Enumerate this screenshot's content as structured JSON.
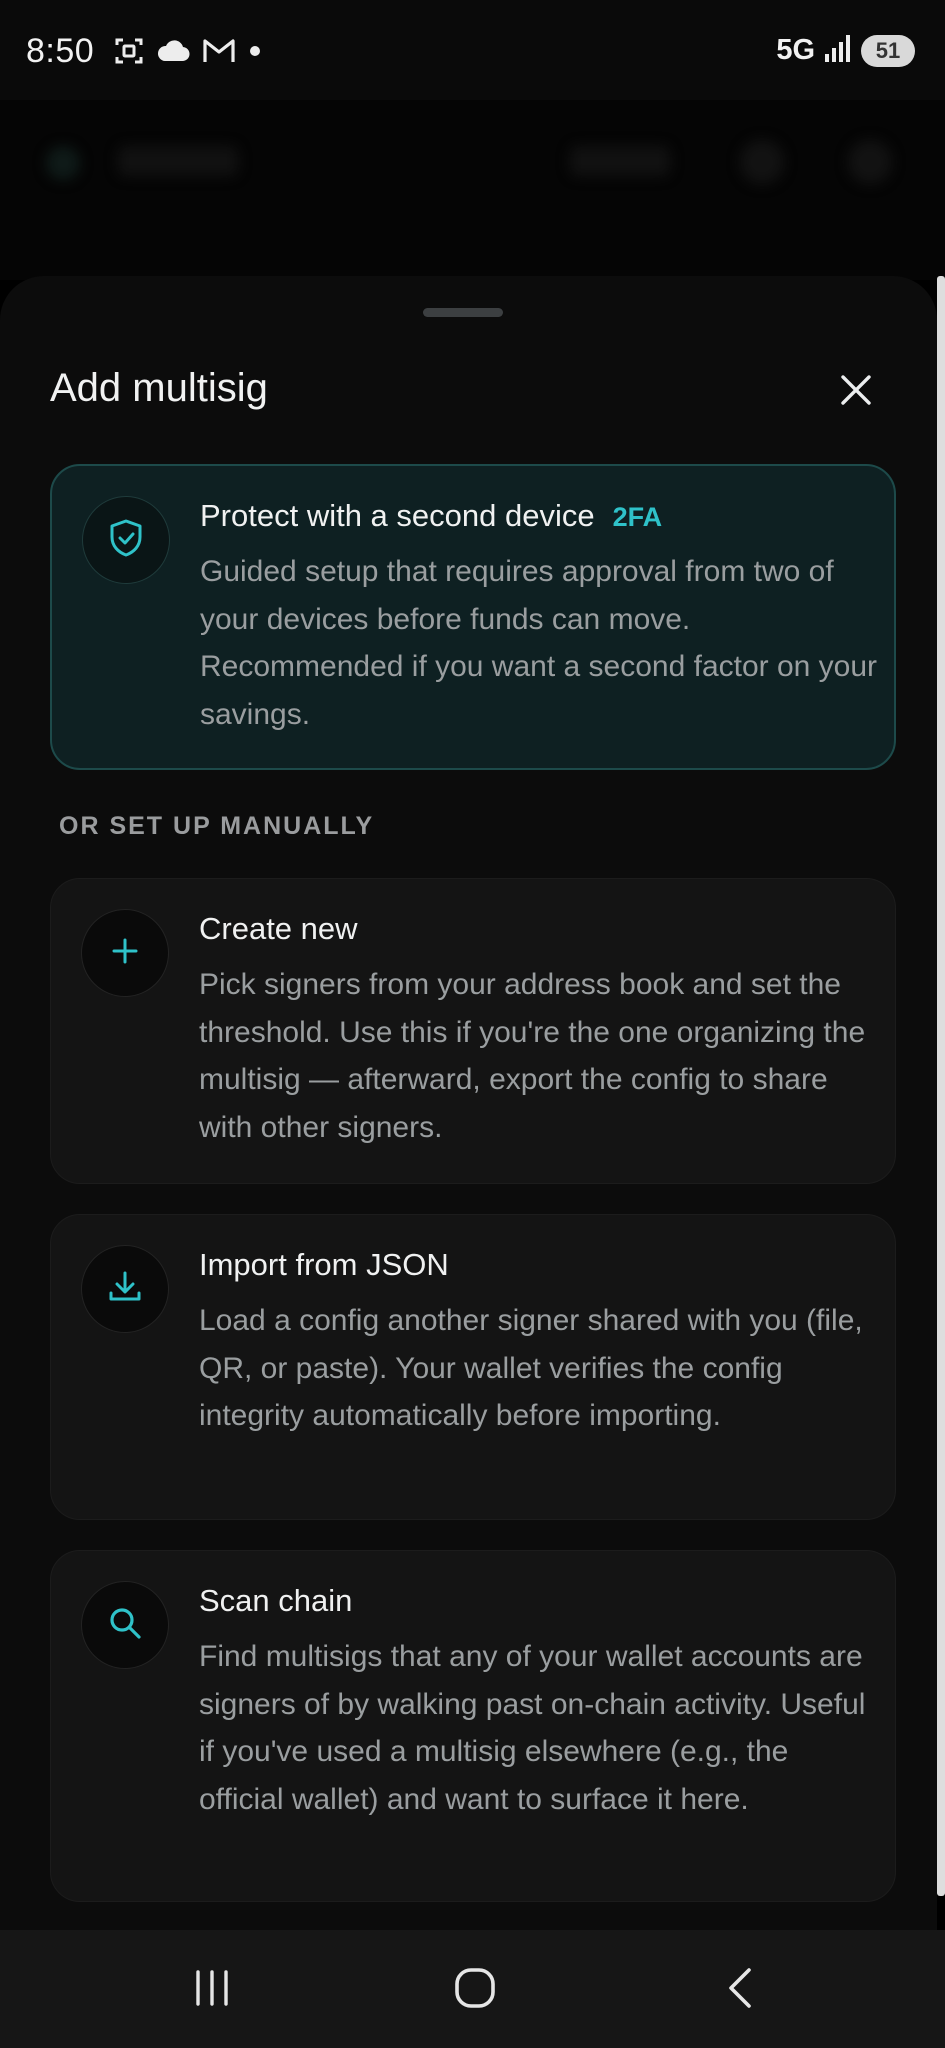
{
  "status_bar": {
    "time": "8:50",
    "network": "5G",
    "battery": "51",
    "icons": [
      "screenshot-icon",
      "cloud-icon",
      "gmail-icon",
      "dot-icon",
      "signal-icon",
      "battery-icon"
    ]
  },
  "sheet": {
    "title": "Add multisig",
    "close_icon": "close-icon"
  },
  "primary_option": {
    "title": "Protect with a second device",
    "badge": "2FA",
    "description": "Guided setup that requires approval from two of your devices before funds can move. Recommended if you want a second factor on your savings.",
    "icon": "shield-check-icon"
  },
  "section_label": "OR SET UP MANUALLY",
  "options": [
    {
      "title": "Create new",
      "description": "Pick signers from your address book and set the threshold. Use this if you're the one organizing the multisig — afterward, export the config to share with other signers.",
      "icon": "plus-icon"
    },
    {
      "title": "Import from JSON",
      "description": "Load a config another signer shared with you (file, QR, or paste). Your wallet verifies the config integrity automatically before importing.",
      "icon": "download-icon"
    },
    {
      "title": "Scan chain",
      "description": "Find multisigs that any of your wallet accounts are signers of by walking past on-chain activity. Useful if you've used a multisig elsewhere (e.g., the official wallet) and want to surface it here.",
      "icon": "search-icon"
    }
  ],
  "nav_bar": {
    "icons": [
      "recents-icon",
      "home-icon",
      "back-icon"
    ]
  },
  "colors": {
    "accent": "#2FC2C9",
    "sheet_background": "#0C0C0C",
    "card_background": "#141414",
    "primary_card_background": "#0E2022",
    "primary_card_border": "#1D4A4A"
  }
}
